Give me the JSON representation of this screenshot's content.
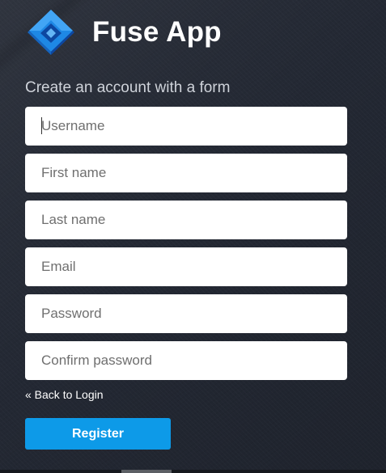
{
  "app": {
    "title": "Fuse App",
    "logo_icon": "fuse-logo-icon",
    "brand_color": "#1e88e5"
  },
  "form": {
    "subtitle": "Create an account with a form",
    "fields": [
      {
        "name": "username",
        "placeholder": "Username",
        "value": ""
      },
      {
        "name": "first_name",
        "placeholder": "First name",
        "value": ""
      },
      {
        "name": "last_name",
        "placeholder": "Last name",
        "value": ""
      },
      {
        "name": "email",
        "placeholder": "Email",
        "value": ""
      },
      {
        "name": "password",
        "placeholder": "Password",
        "value": ""
      },
      {
        "name": "confirm_password",
        "placeholder": "Confirm password",
        "value": ""
      }
    ],
    "back_link": "« Back to Login",
    "register_label": "Register",
    "register_color": "#0d9ae8"
  }
}
